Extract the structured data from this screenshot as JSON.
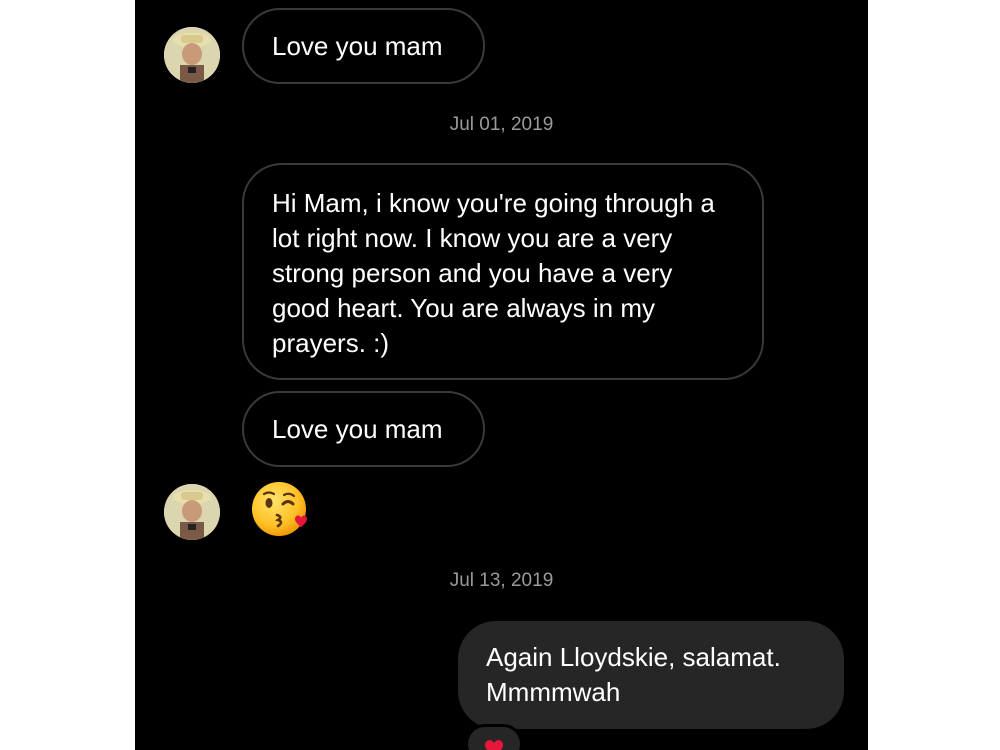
{
  "thread": {
    "messages": [
      {
        "text": "Love you mam"
      },
      {
        "text": "Hi Mam, i know you're going through a lot right now. I know you are a very strong person and you have a very good heart. You are always in my prayers. :)"
      },
      {
        "text": "Love you mam"
      },
      {
        "text": "Again Lloydskie, salamat. Mmmmwah"
      }
    ],
    "timestamps": [
      "Jul 01, 2019",
      "Jul 13, 2019"
    ],
    "emoji_message": "kiss-wink-heart-emoji",
    "reaction": "heart-reaction-icon"
  },
  "colors": {
    "background": "#000000",
    "incoming_border": "#3a3a3a",
    "outgoing_bubble": "#262626",
    "timestamp": "#9a9a9a",
    "text": "#ffffff",
    "heart": "#e8163a"
  }
}
